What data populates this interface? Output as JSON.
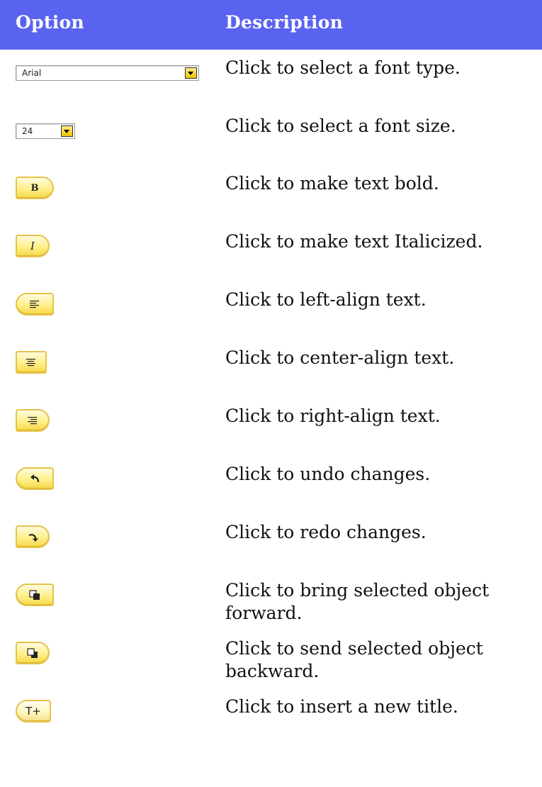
{
  "header": {
    "option": "Option",
    "description": "Description"
  },
  "rows": [
    {
      "option_kind": "font-combo",
      "option_value": "Arial",
      "description": "Click to select a font type."
    },
    {
      "option_kind": "size-combo",
      "option_value": "24",
      "description": "Click to select a font size."
    },
    {
      "option_kind": "bold-button",
      "option_value": "B",
      "description": "Click to make text bold."
    },
    {
      "option_kind": "italic-button",
      "option_value": "I",
      "description": "Click to make text Italicized."
    },
    {
      "option_kind": "align-left-button",
      "option_value": "",
      "description": "Click to left-align text."
    },
    {
      "option_kind": "align-center-button",
      "option_value": "",
      "description": "Click to center-align text."
    },
    {
      "option_kind": "align-right-button",
      "option_value": "",
      "description": "Click to right-align text."
    },
    {
      "option_kind": "undo-button",
      "option_value": "",
      "description": "Click to undo changes."
    },
    {
      "option_kind": "redo-button",
      "option_value": "",
      "description": "Click to redo changes."
    },
    {
      "option_kind": "bring-forward-button",
      "option_value": "",
      "description": "Click to bring selected object forward."
    },
    {
      "option_kind": "send-backward-button",
      "option_value": "",
      "description": "Click to send selected object backward."
    },
    {
      "option_kind": "insert-title-button",
      "option_value": "T+",
      "description": "Click to insert a new title."
    }
  ],
  "colors": {
    "header_bg": "#5a63f0",
    "header_text": "#ffffff",
    "button_fill": "#fff08a",
    "button_border": "#e6c24a"
  }
}
